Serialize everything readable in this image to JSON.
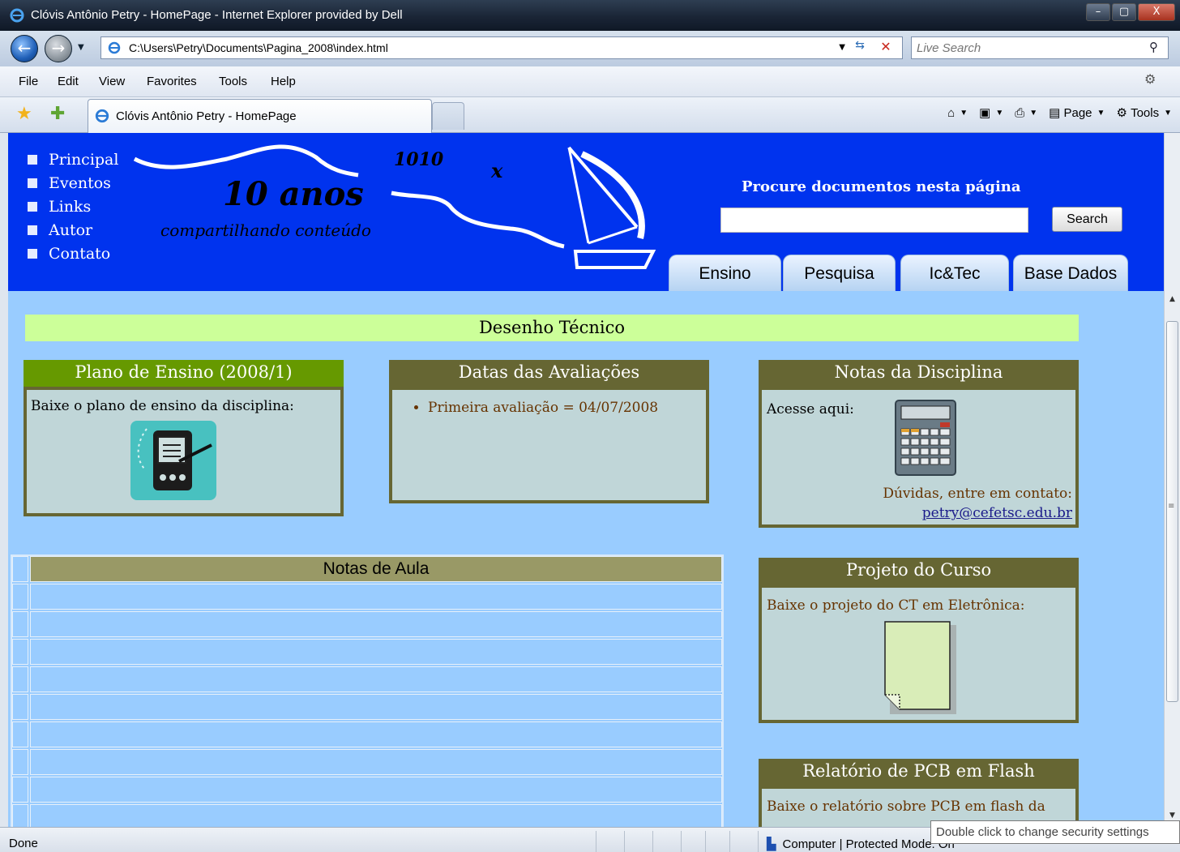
{
  "window": {
    "title": "Clóvis Antônio Petry - HomePage - Internet Explorer provided by Dell",
    "minimize": "–",
    "maximize": "▢",
    "close": "X"
  },
  "address_bar": {
    "url": "C:\\Users\\Petry\\Documents\\Pagina_2008\\index.html",
    "search_placeholder": "Live Search"
  },
  "menu": [
    "File",
    "Edit",
    "View",
    "Favorites",
    "Tools",
    "Help"
  ],
  "tab": {
    "label": "Clóvis Antônio Petry - HomePage"
  },
  "command_bar": {
    "page": "Page",
    "tools": "Tools"
  },
  "site": {
    "nav": [
      "Principal",
      "Eventos",
      "Links",
      "Autor",
      "Contato"
    ],
    "banner": {
      "headline": "10 anos",
      "subtitle": "compartilhando conteúdo",
      "number": "1010",
      "x_mark": "x"
    },
    "search": {
      "label": "Procure documentos nesta página",
      "button": "Search"
    },
    "tabs": [
      "Ensino",
      "Pesquisa",
      "Ic&Tec",
      "Base Dados"
    ],
    "section_title": "Desenho Técnico",
    "plano": {
      "title": "Plano de Ensino (2008/1)",
      "text": "Baixe o plano de ensino da disciplina:"
    },
    "datas": {
      "title": "Datas das Avaliações",
      "items": [
        "Primeira avaliação = 04/07/2008"
      ]
    },
    "notas_disc": {
      "title": "Notas da Disciplina",
      "text": "Acesse aqui:",
      "contact": "Dúvidas, entre em contato:",
      "email": "petry@cefetsc.edu.br"
    },
    "notas_aula": {
      "title": "Notas de Aula"
    },
    "projeto": {
      "title": "Projeto do Curso",
      "text": "Baixe o projeto do CT em Eletrônica:"
    },
    "relatorio": {
      "title": "Relatório de PCB em Flash",
      "text": "Baixe o relatório sobre PCB em flash da"
    }
  },
  "status": {
    "text": "Done",
    "zone": "Computer | Protected Mode: On",
    "tooltip": "Double click to change security settings"
  },
  "colors": {
    "banner": "#0033ee",
    "page_bg": "#99ccff",
    "section_title_bg": "#ccff99",
    "plano_head": "#669900",
    "box_head": "#666633",
    "box_border": "#666633",
    "box_body": "#c0d6d8",
    "notas_aula_head": "#999966"
  }
}
